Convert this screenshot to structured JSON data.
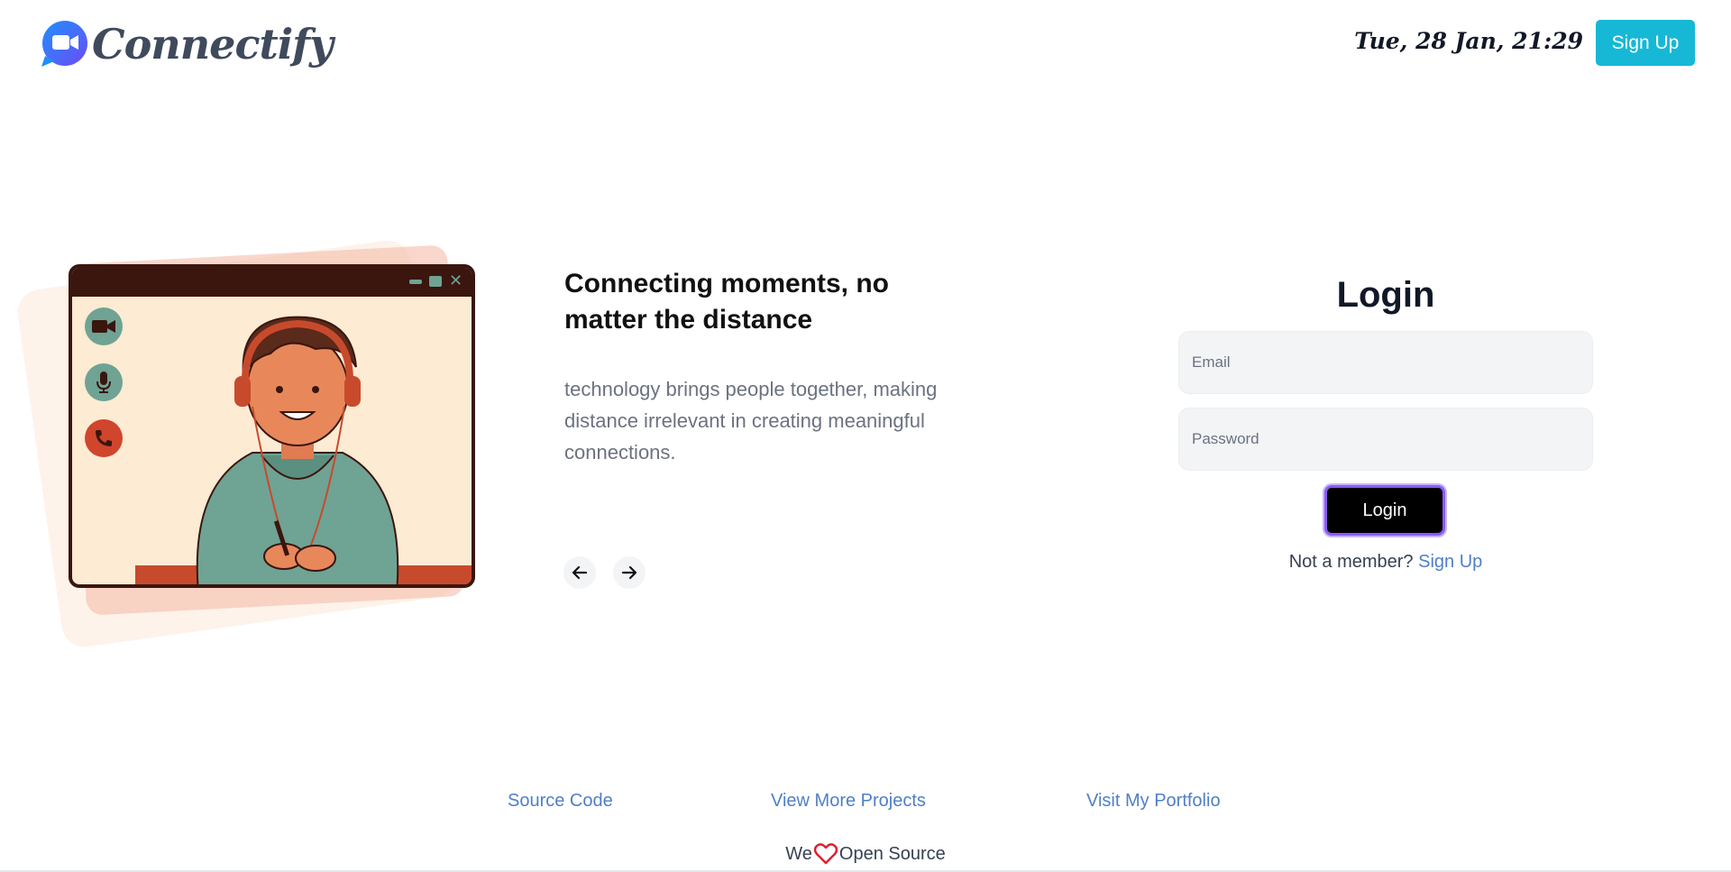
{
  "header": {
    "brand_name": "Connectify",
    "datetime": "Tue, 28 Jan, 21:29",
    "signup_label": "Sign Up"
  },
  "hero": {
    "title": "Connecting moments, no matter the distance",
    "description": "technology brings people together, making distance irrelevant in creating meaningful connections.",
    "prev_icon": "arrow-left-icon",
    "next_icon": "arrow-right-icon"
  },
  "login": {
    "title": "Login",
    "email_placeholder": "Email",
    "password_placeholder": "Password",
    "button_label": "Login",
    "member_text": "Not a member?",
    "member_link": "Sign Up"
  },
  "footer": {
    "links": [
      "Source Code",
      "View More Projects",
      "Visit My Portfolio"
    ],
    "love_prefix": "We",
    "love_suffix": "Open Source"
  },
  "colors": {
    "accent": "#17b8d6",
    "link": "#4f7fc7",
    "login_button_border": "#8b5cf6",
    "heart": "#e11d2e"
  }
}
